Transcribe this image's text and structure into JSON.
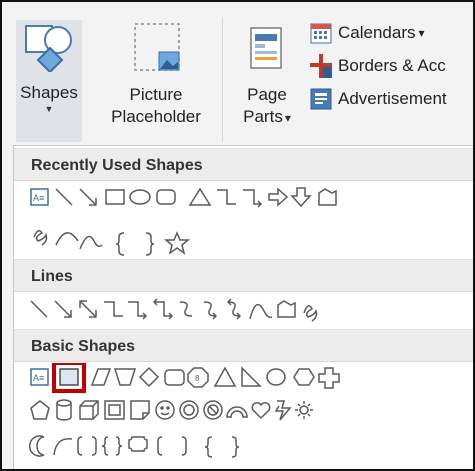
{
  "ribbon": {
    "shapes_label": "Shapes",
    "picture_label_1": "Picture",
    "picture_label_2": "Placeholder",
    "page_label_1": "Page",
    "page_label_2": "Parts",
    "page_caret": "▾",
    "calendars_label": "Calendars",
    "calendars_caret": "▾",
    "borders_label": "Borders & Acc",
    "advertisements_label": "Advertisement"
  },
  "menu": {
    "recent_title": "Recently Used Shapes",
    "lines_title": "Lines",
    "basic_title": "Basic Shapes"
  },
  "colors": {
    "selection": "#c00000",
    "ribbon_bg": "#f3f3f3",
    "header_bg": "#ececec",
    "stroke": "#5a5a5a"
  }
}
